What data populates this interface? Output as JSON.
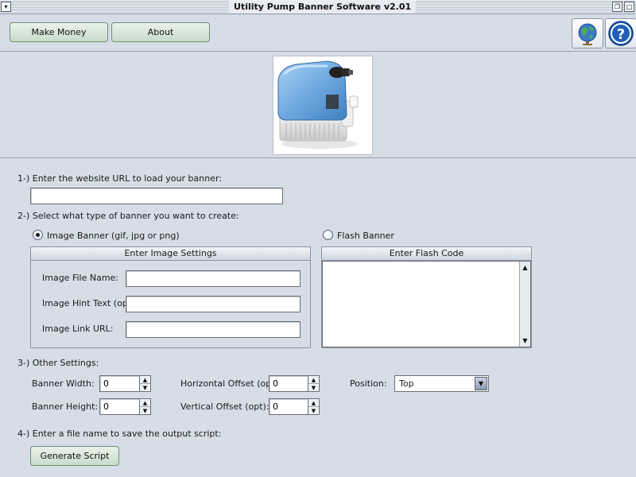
{
  "window": {
    "title": "Utility Pump Banner Software v2.01",
    "menu_glyph": "▾",
    "restore_glyph": "❐",
    "maximize_glyph": "□"
  },
  "toolbar": {
    "make_money_label": "Make Money",
    "about_label": "About",
    "globe_icon": "globe-icon",
    "help_icon": "help-icon"
  },
  "banner": {
    "image_icon": "utility-pump-image"
  },
  "step1": {
    "label": "1-) Enter the website URL to load your banner:",
    "url_value": ""
  },
  "step2": {
    "label": "2-) Select what type of banner you want to create:",
    "image_option": "Image Banner (gif, jpg or png)",
    "flash_option": "Flash Banner",
    "selected": "image",
    "image_panel": {
      "header": "Enter Image Settings",
      "file_name_label": "Image File Name:",
      "file_name_value": "",
      "hint_label": "Image Hint Text (opt):",
      "hint_value": "",
      "link_label": "Image Link URL:",
      "link_value": ""
    },
    "flash_panel": {
      "header": "Enter Flash Code",
      "code_value": ""
    }
  },
  "step3": {
    "label": "3-) Other Settings:",
    "width_label": "Banner Width:",
    "width_value": "0",
    "height_label": "Banner Height:",
    "height_value": "0",
    "h_offset_label": "Horizontal Offset (opt):",
    "h_offset_value": "0",
    "v_offset_label": "Vertical Offset (opt):",
    "v_offset_value": "0",
    "position_label": "Position:",
    "position_value": "Top"
  },
  "step4": {
    "label": "4-) Enter a file name to save the output script:",
    "generate_label": "Generate Script"
  },
  "colors": {
    "background": "#d6dde7",
    "button_green": "#c8dcc9",
    "pump_blue": "#6fa9e0"
  }
}
